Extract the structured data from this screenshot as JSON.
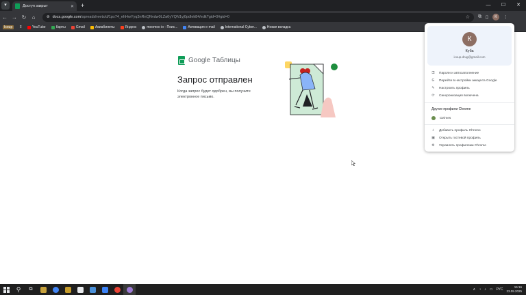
{
  "browser": {
    "tab_title": "Доступ закрыт",
    "new_tab": "+",
    "url_host": "docs.google.com",
    "url_path": "/spreadsheets/d/1px74_ehHwYyq3nRnQNvdw0LZa6yYQN1yj0pdlek84/edit?gid=0#gid=0"
  },
  "bookmarks": [
    {
      "label": "Icoup",
      "color": "#8a6d3b"
    },
    {
      "label": "YouTube",
      "color": "#ff0000"
    },
    {
      "label": "Карты",
      "color": "#34a853"
    },
    {
      "label": "Gmail",
      "color": "#ea4335"
    },
    {
      "label": "Авиабилеты",
      "color": "#fbbc04"
    },
    {
      "label": "Яндекс",
      "color": "#fc3f1d"
    },
    {
      "label": "moomoo io - Поис...",
      "color": "#bdc1c6"
    },
    {
      "label": "Активация e-mail",
      "color": "#4285f4"
    },
    {
      "label": "International Cyber...",
      "color": "#bdc1c6"
    },
    {
      "label": "Новая вкладка",
      "color": "#bdc1c6"
    }
  ],
  "page": {
    "brand": "Google Таблицы",
    "headline": "Запрос отправлен",
    "subtext": "Когда запрос будет одобрен, вы получите электронное письмо."
  },
  "profile_menu": {
    "avatar_letter": "К",
    "name": "Куба",
    "email": "icoup.drug@gmail.com",
    "items": [
      {
        "icon": "key-icon",
        "glyph": "⚿",
        "label": "Пароли и автозаполнение"
      },
      {
        "icon": "google-icon",
        "glyph": "G",
        "label": "Перейти в настройки аккаунта Google"
      },
      {
        "icon": "pencil-icon",
        "glyph": "✎",
        "label": "Настроить профиль"
      },
      {
        "icon": "sync-icon",
        "glyph": "⟳",
        "label": "Синхронизация включена"
      }
    ],
    "other_profiles_heading": "Другие профили Chrome",
    "other_profile": "Ozimes",
    "bottom_items": [
      {
        "icon": "add-profile-icon",
        "glyph": "+",
        "label": "Добавить профиль Chrome"
      },
      {
        "icon": "guest-icon",
        "glyph": "▣",
        "label": "Открыть гостевой профиль"
      },
      {
        "icon": "manage-profiles-icon",
        "glyph": "⚙",
        "label": "Управлять профилями Chrome"
      }
    ]
  },
  "taskbar": {
    "language": "РУС",
    "time": "15:16",
    "date": "23.09.2025",
    "apps": [
      "#c8a23c",
      "#4285f4",
      "#c69c2b",
      "#e8eaed",
      "#4a90d9",
      "#3b82f6",
      "#ea4335",
      "#9e7bd6"
    ]
  }
}
